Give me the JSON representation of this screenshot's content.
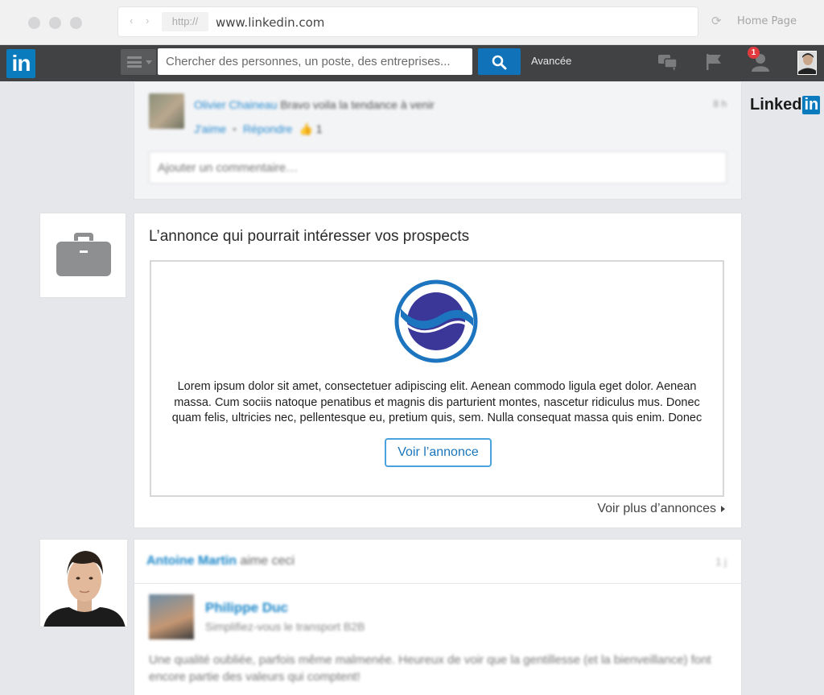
{
  "browser": {
    "protocol": "http://",
    "url": "www.linkedin.com",
    "home_label": "Home Page"
  },
  "topbar": {
    "logo_text": "in",
    "search_placeholder": "Chercher des personnes, un poste, des entreprises...",
    "advanced_label": "Avancée",
    "notification_count": "1",
    "brand_color": "#0a7bbd"
  },
  "side_logo": {
    "word": "Linked",
    "box": "in"
  },
  "comment": {
    "author": "Olivier Chaineau",
    "text": "Bravo voila la tendance à venir",
    "like_label": "J'aime",
    "reply_label": "Répondre",
    "like_count": "1",
    "time": "8 h",
    "input_placeholder": "Ajouter un commentaire…"
  },
  "ad": {
    "heading": "L’annonce qui pourrait intéresser vos prospects",
    "body": "Lorem ipsum dolor sit amet, consectetuer adipiscing elit. Aenean commodo ligula eget dolor. Aenean massa. Cum sociis natoque penatibus et magnis dis parturient montes, nascetur ridiculus mus. Donec quam felis, ultricies nec, pellentesque eu, pretium quis, sem. Nulla consequat massa quis enim. Donec",
    "button_label": "Voir l’annonce",
    "more_label": "Voir plus d’annonces"
  },
  "activity": {
    "actor": "Antoine Martin",
    "verb": "aime ceci",
    "time": "1 j",
    "post_author": "Philippe Duc",
    "post_subtitle": "Simplifiez-vous le transport B2B",
    "post_body": "Une qualité oubliée, parfois même malmenée. Heureux de voir que la gentillesse (et la bienveillance) font encore partie des valeurs qui comptent!"
  }
}
